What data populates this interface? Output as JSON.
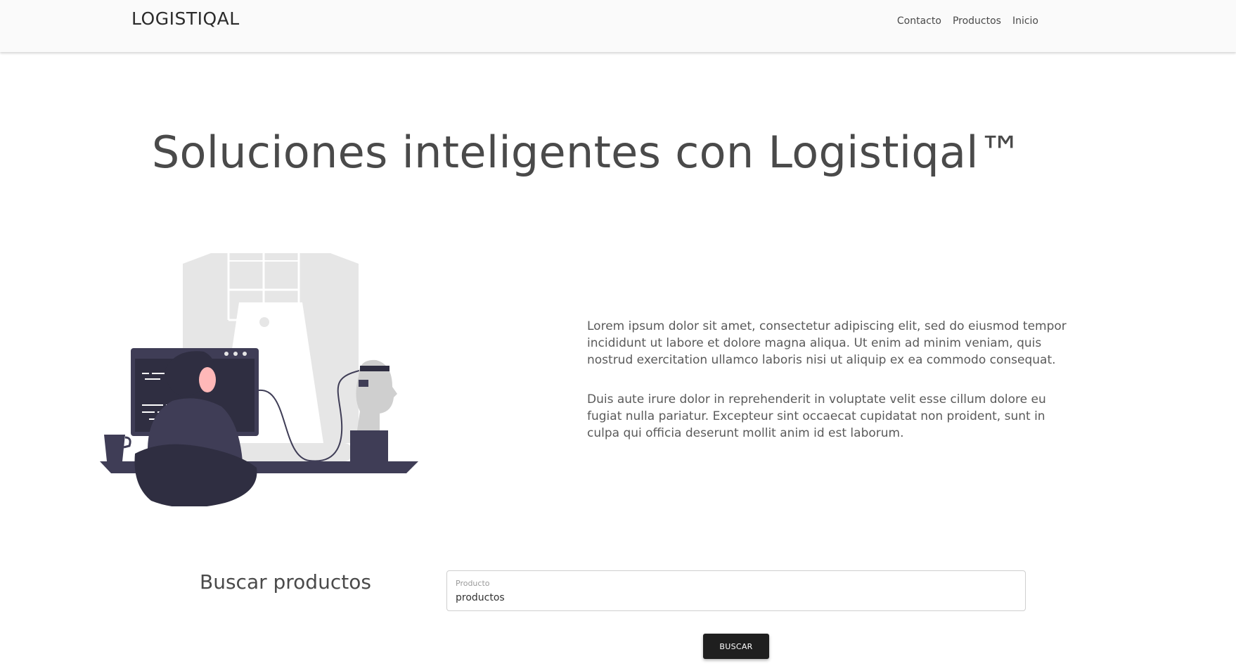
{
  "navbar": {
    "brand": "LOGISTIQAL",
    "links": [
      "Contacto",
      "Productos",
      "Inicio"
    ]
  },
  "hero": {
    "title": "Soluciones inteligentes con Logistiqal™"
  },
  "content": {
    "paragraphs": [
      "Lorem ipsum dolor sit amet, consectetur adipiscing elit, sed do eiusmod tempor incididunt ut labore et dolore magna aliqua. Ut enim ad minim veniam, quis nostrud exercitation ullamco laboris nisi ut aliquip ex ea commodo consequat.",
      "Duis aute irure dolor in reprehenderit in voluptate velit esse cillum dolore eu fugiat nulla pariatur. Excepteur sint occaecat cupidatat non proident, sunt in culpa qui officia deserunt mollit anim id est laborum."
    ]
  },
  "search": {
    "heading": "Buscar productos",
    "field_label": "Producto",
    "field_value": "productos",
    "button_label": "BUSCAR"
  },
  "colors": {
    "navbar_bg": "#fafafa",
    "text": "#4a4a4a",
    "button_bg": "#1f1f1f",
    "illustration_dark": "#3f3d56",
    "illustration_light": "#e6e6e6",
    "skin": "#ffb8b8"
  },
  "icons": {
    "hero_illustration": "person-at-computer-illustration"
  }
}
